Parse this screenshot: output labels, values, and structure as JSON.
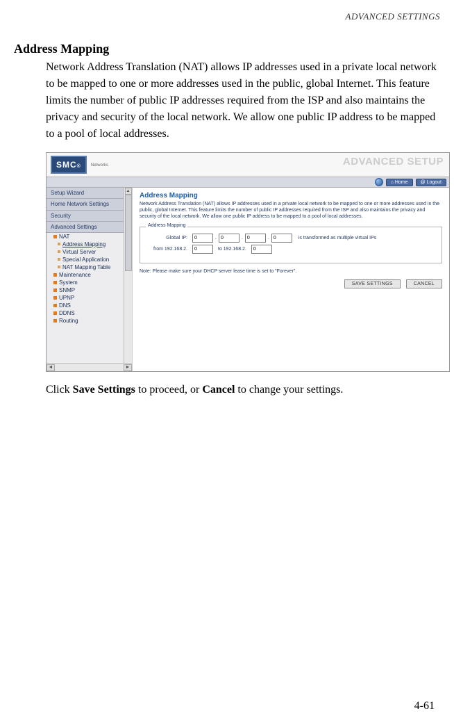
{
  "page": {
    "header": "ADVANCED SETTINGS",
    "section_title": "Address Mapping",
    "intro": "Network Address Translation (NAT) allows IP addresses used in a private local network to be mapped to one or more addresses used in the public, global Internet. This feature limits the number of public IP addresses required from the ISP and also maintains the privacy and security of the local network. We allow one public IP address to be mapped to a pool of local addresses.",
    "closing_pre": "Click ",
    "closing_save": "Save Settings",
    "closing_mid": " to proceed, or ",
    "closing_cancel": "Cancel",
    "closing_post": " to change your settings.",
    "page_number": "4-61"
  },
  "screenshot": {
    "logo": "SMC",
    "logo_sup": "®",
    "logo_sub": "Networks",
    "adv_setup": "ADVANCED SETUP",
    "home_btn": "Home",
    "logout_btn": "Logout",
    "sidebar": {
      "top": [
        "Setup Wizard",
        "Home Network\nSettings",
        "Security",
        "Advanced Settings"
      ],
      "nat_label": "NAT",
      "nat_children": [
        "Address Mapping",
        "Virtual Server",
        "Special Application",
        "NAT Mapping Table"
      ],
      "rest": [
        "Maintenance",
        "System",
        "SNMP",
        "UPNP",
        "DNS",
        "DDNS",
        "Routing"
      ]
    },
    "main": {
      "title": "Address Mapping",
      "desc": "Network Address Translation (NAT) allows IP addresses used in a private local network to be mapped to one or more addresses used in the public, global Internet. This feature limits the number of public IP addresses required from the ISP and also maintains the privacy and security of the local network. We allow one public IP address to be mapped to a pool of local addresses.",
      "legend": "Address Mapping",
      "row1_label": "Global IP:",
      "row1_tail": "is transformed as multiple virtual IPs",
      "row2_pre": "from 192.168.2.",
      "row2_mid": "to 192.168.2.",
      "ip": {
        "a": "0",
        "b": "0",
        "c": "0",
        "d": "0",
        "from": "0",
        "to": "0"
      },
      "note": "Note: Please make sure your DHCP server lease time is set to \"Forever\".",
      "save_btn": "SAVE SETTINGS",
      "cancel_btn": "CANCEL"
    }
  }
}
